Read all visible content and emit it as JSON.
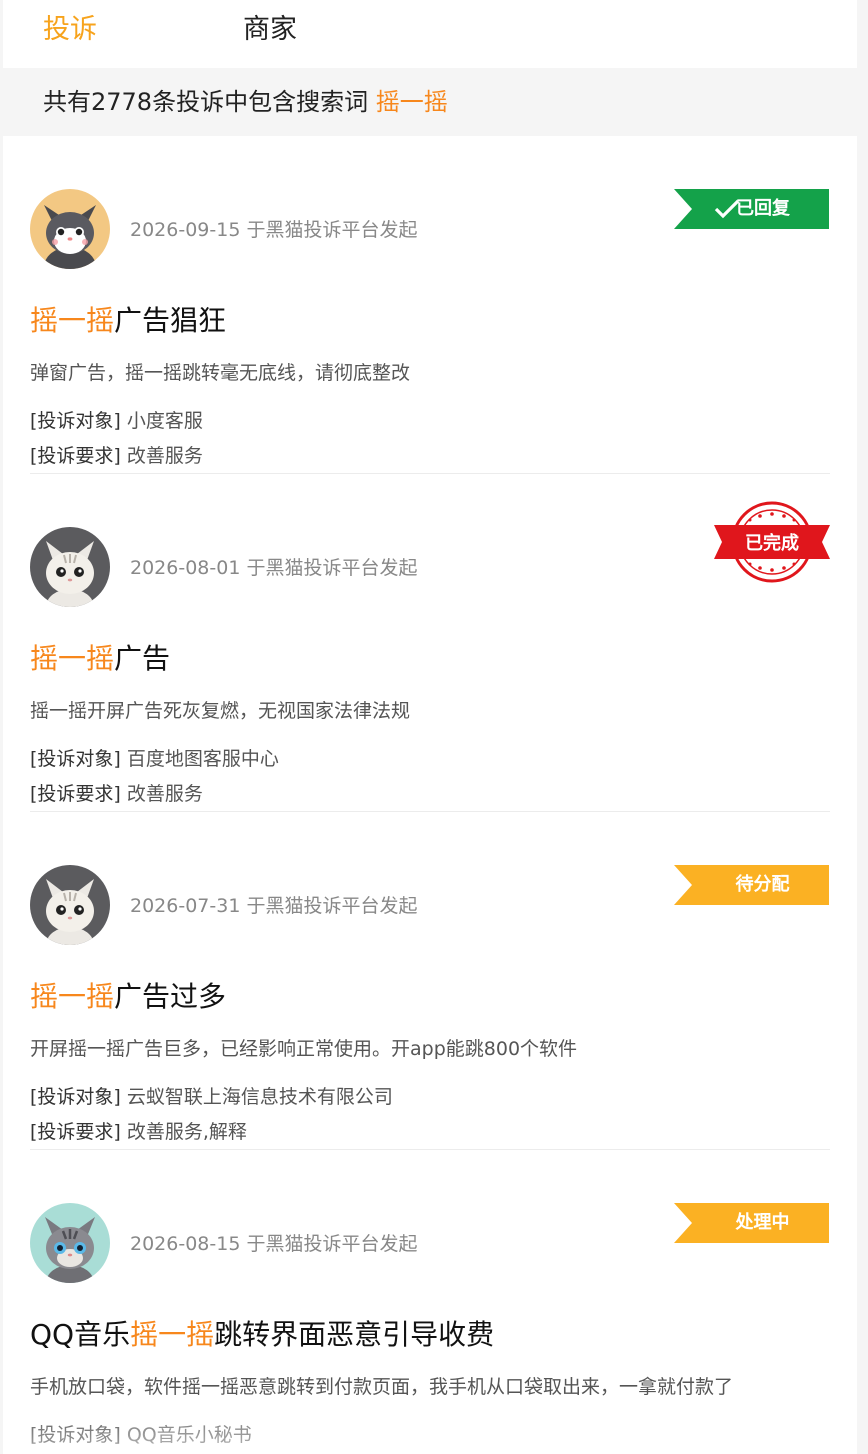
{
  "tabs": {
    "complaint": "投诉",
    "merchant": "商家"
  },
  "summary": {
    "prefix": "共有2778条投诉中包含搜索词 ",
    "keyword": "摇一摇"
  },
  "labels": {
    "target": "[投诉对象]",
    "demand": "[投诉要求]"
  },
  "colors": {
    "accent": "#f7a31c",
    "keyword": "#f7871c",
    "replied": "#14a24a",
    "done": "#e0161c",
    "pending": "#fbb123"
  },
  "complaints": [
    {
      "avatar": "gray-cat-orange-bg",
      "meta": "2026-09-15 于黑猫投诉平台发起",
      "status": "已回复",
      "status_icon": "check-icon",
      "title_pre": "",
      "title_kw": "摇一摇",
      "title_post": "广告猖狂",
      "desc": "弹窗广告，摇一摇跳转毫无底线，请彻底整改",
      "target": "小度客服",
      "demand": "改善服务"
    },
    {
      "avatar": "white-cat-gray-bg",
      "meta": "2026-08-01 于黑猫投诉平台发起",
      "status": "已完成",
      "status_icon": "seal-stamp",
      "title_pre": "",
      "title_kw": "摇一摇",
      "title_post": "广告",
      "desc": "摇一摇开屏广告死灰复燃，无视国家法律法规",
      "target": "百度地图客服中心",
      "demand": "改善服务"
    },
    {
      "avatar": "white-cat-gray-bg",
      "meta": "2026-07-31 于黑猫投诉平台发起",
      "status": "待分配",
      "title_pre": "",
      "title_kw": "摇一摇",
      "title_post": "广告过多",
      "desc": "开屏摇一摇广告巨多，已经影响正常使用。开app能跳800个软件",
      "target": "云蚁智联上海信息技术有限公司",
      "demand": "改善服务,解释"
    },
    {
      "avatar": "tabby-cat-teal-bg",
      "meta": "2026-08-15 于黑猫投诉平台发起",
      "status": "处理中",
      "title_pre": "QQ音乐",
      "title_kw": "摇一摇",
      "title_post": "跳转界面恶意引导收费",
      "desc": "手机放口袋，软件摇一摇恶意跳转到付款页面，我手机从口袋取出来，一拿就付款了",
      "target": "QQ音乐小秘书",
      "demand": ""
    }
  ]
}
